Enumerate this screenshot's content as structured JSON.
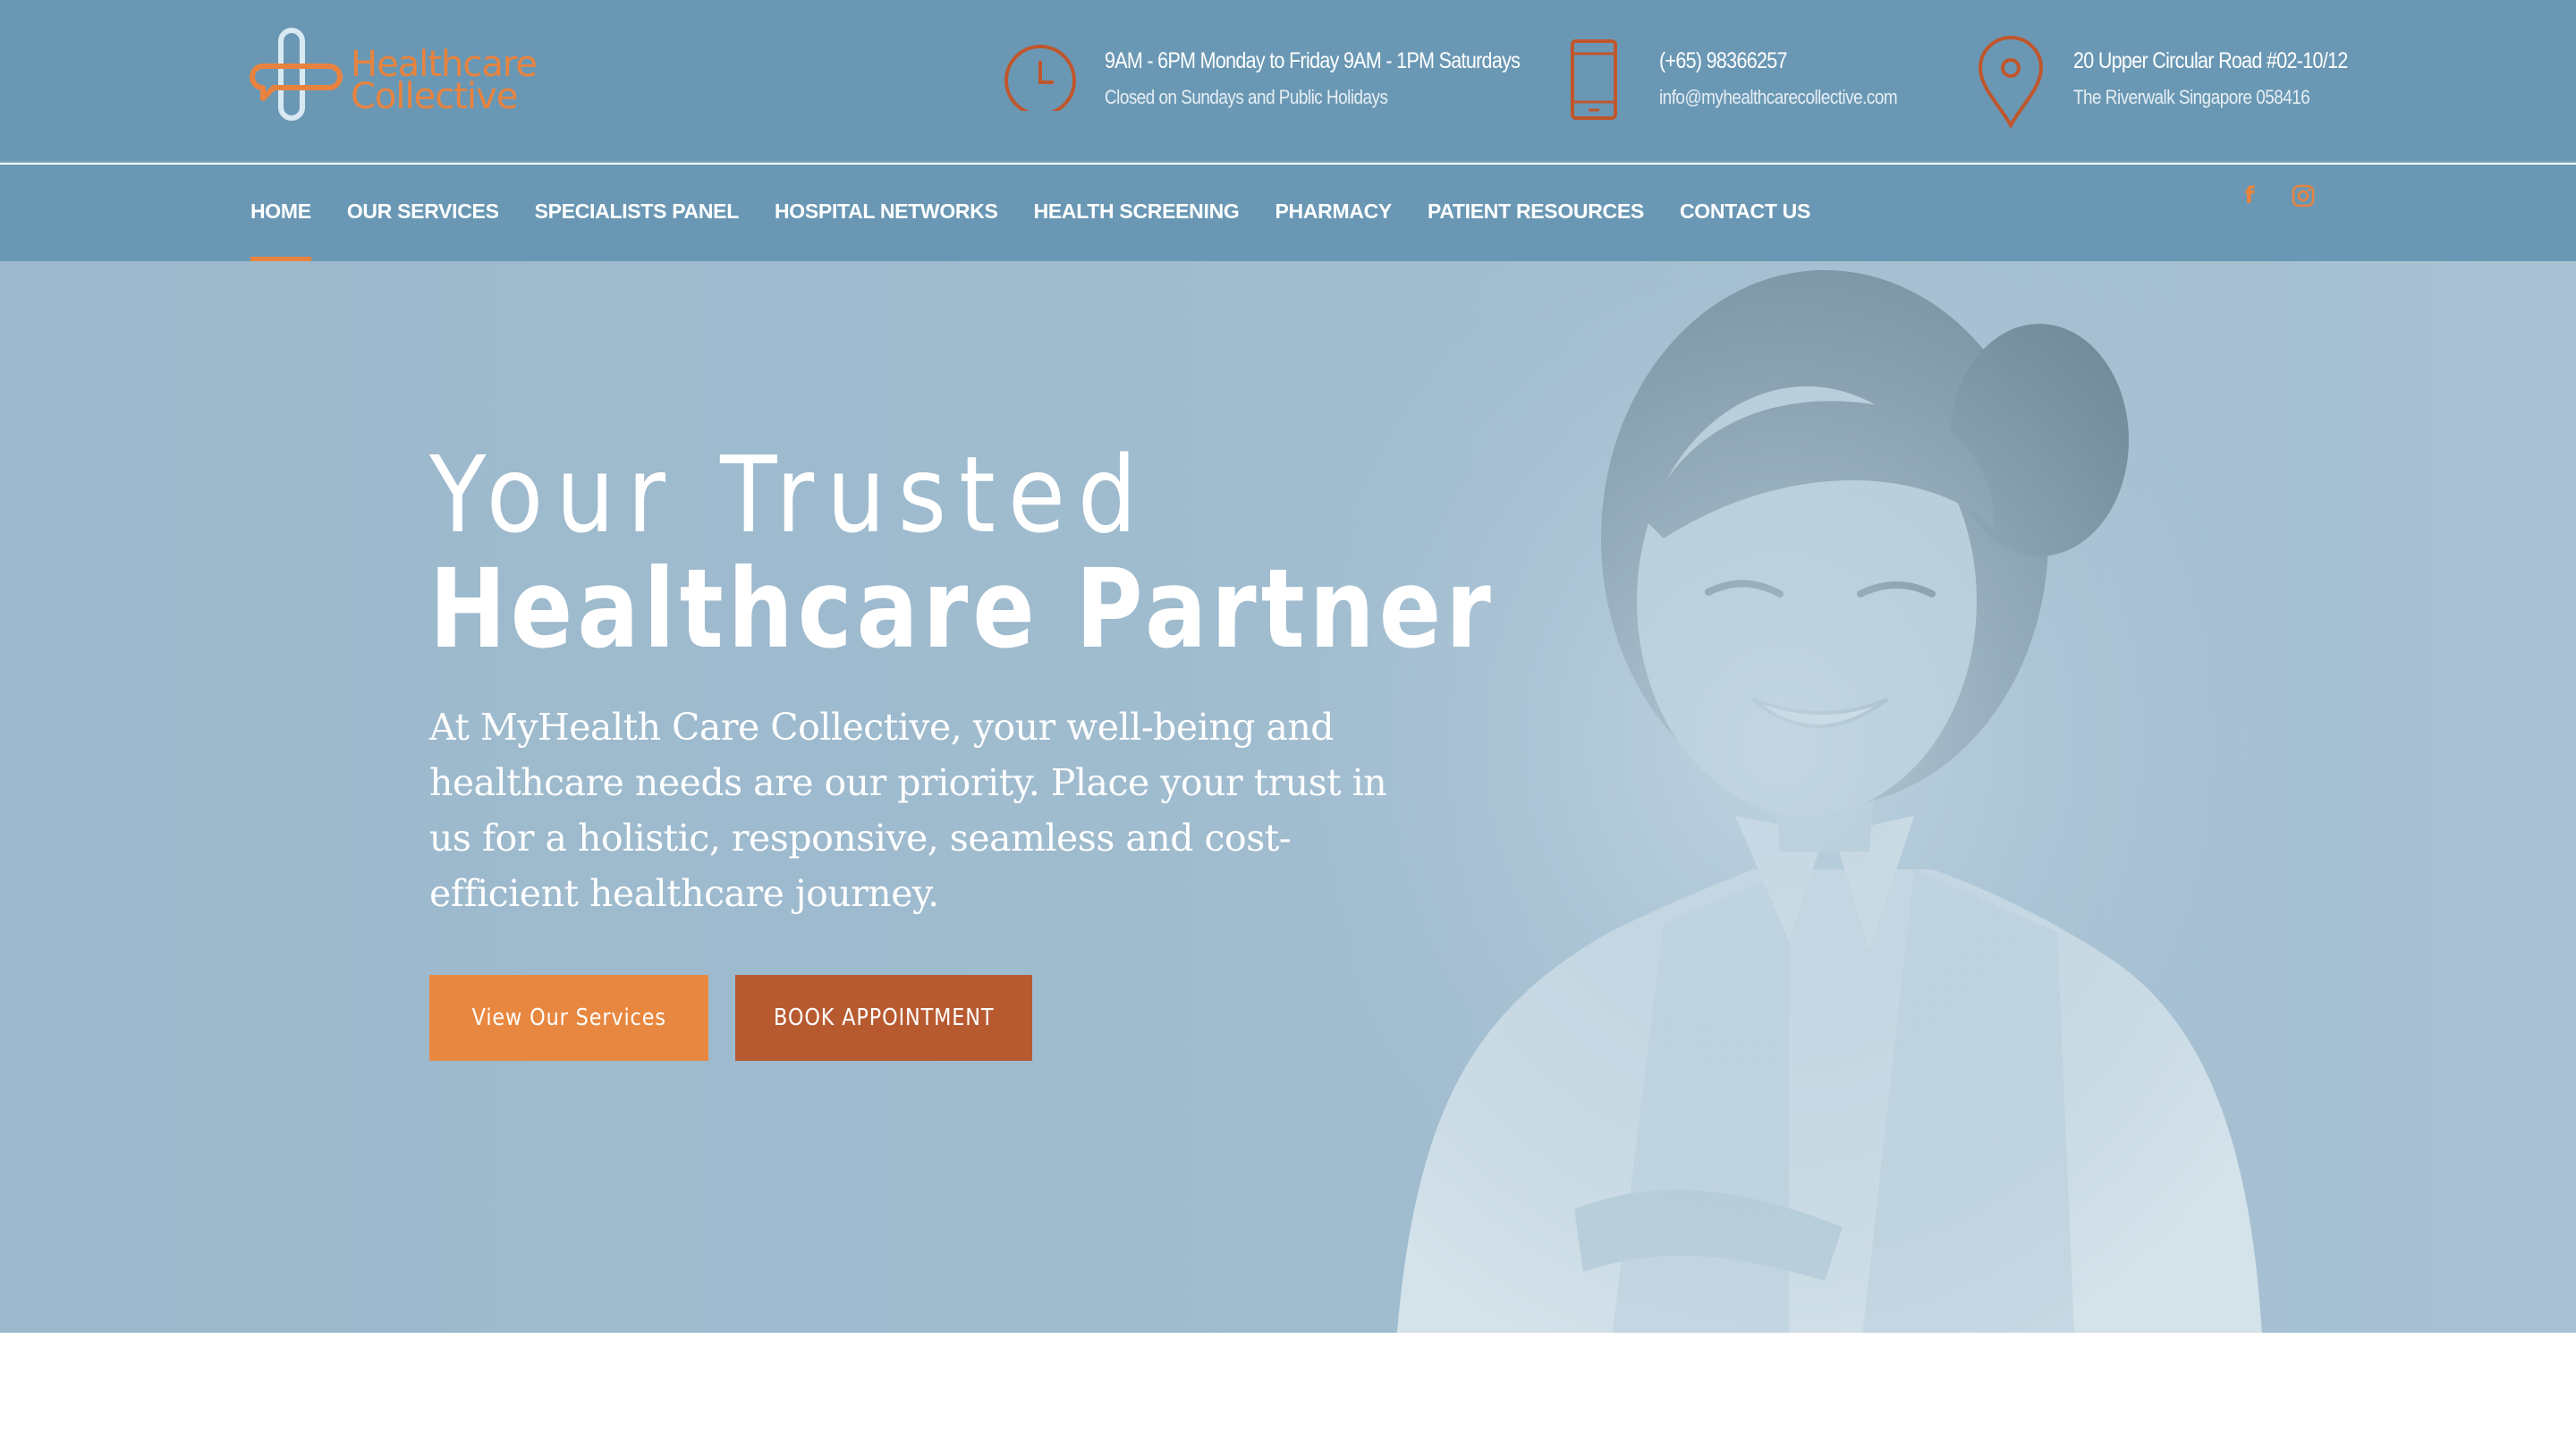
{
  "brand": {
    "logo_line1": "Healthcare",
    "logo_line2": "Collective",
    "accent_color": "#e8833f",
    "header_color": "#6a98b4"
  },
  "header": {
    "hours": {
      "icon": "clock-icon",
      "line1": "9AM - 6PM Monday to Friday 9AM - 1PM Saturdays",
      "line2": "Closed on Sundays and Public Holidays"
    },
    "contact": {
      "icon": "phone-icon",
      "line1": "(+65) 98366257",
      "line2": "info@myhealthcarecollective.com"
    },
    "address": {
      "icon": "map-pin-icon",
      "line1": "20 Upper Circular Road #02-10/12",
      "line2": "The Riverwalk Singapore 058416"
    }
  },
  "nav": {
    "items": [
      {
        "label": "HOME",
        "active": true
      },
      {
        "label": "OUR SERVICES"
      },
      {
        "label": "SPECIALISTS PANEL"
      },
      {
        "label": "HOSPITAL NETWORKS"
      },
      {
        "label": "HEALTH SCREENING"
      },
      {
        "label": "PHARMACY"
      },
      {
        "label": "PATIENT RESOURCES"
      },
      {
        "label": "CONTACT US"
      }
    ],
    "social": [
      "facebook-icon",
      "instagram-icon"
    ]
  },
  "hero": {
    "headline_line1": "Your Trusted",
    "headline_line2": "Healthcare Partner",
    "lede": "At MyHealth Care Collective, your well-being and healthcare needs are our priority. Place your trust in us for a holistic, responsive, seamless and cost-efficient healthcare journey.",
    "primary_button": "View Our Services",
    "secondary_button": "BOOK APPOINTMENT"
  }
}
